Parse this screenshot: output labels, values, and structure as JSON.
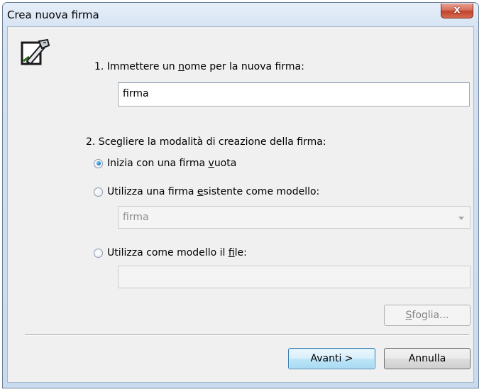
{
  "window": {
    "title": "Crea nuova firma",
    "close_label": "x"
  },
  "step1": {
    "label_before": "1. Immettere un ",
    "label_accel": "n",
    "label_after": "ome per la nuova firma:",
    "name_value": "firma"
  },
  "step2": {
    "label": "2. Scegliere la modalità di creazione della firma:",
    "options": [
      {
        "before": "Inizia con una firma ",
        "accel": "v",
        "after": "uota",
        "checked": true
      },
      {
        "before": "Utilizza una firma ",
        "accel": "e",
        "after": "sistente come modello:",
        "checked": false
      },
      {
        "before": "Utilizza come modello il ",
        "accel": "f",
        "after": "ile:",
        "checked": false
      }
    ],
    "existing_select_value": "firma",
    "file_value": ""
  },
  "buttons": {
    "browse_accel": "S",
    "browse_rest": "foglia...",
    "next": "Avanti >",
    "cancel": "Annulla"
  },
  "icons": {
    "pen": "signature-pen-icon",
    "close": "close-icon",
    "dropdown": "chevron-down-icon"
  }
}
